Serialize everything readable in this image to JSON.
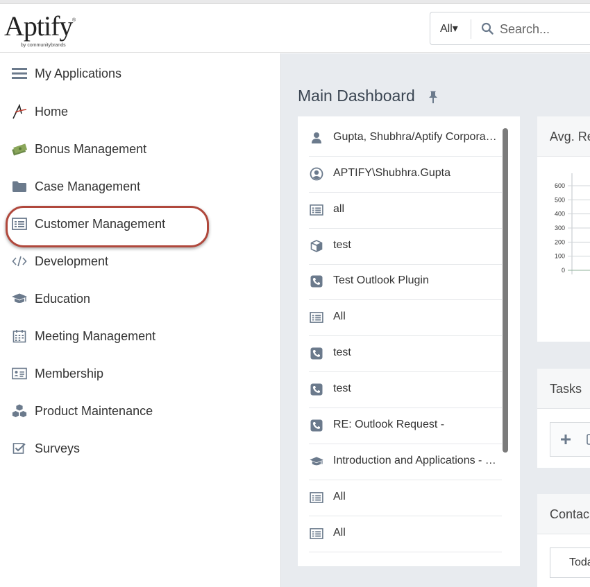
{
  "brand": {
    "logo_text": "Aptify",
    "logo_reg": "®",
    "logo_sub": "by communitybrands"
  },
  "search": {
    "scope": "All▾",
    "placeholder": "Search..."
  },
  "sidebar": {
    "items": [
      {
        "label": "My Applications",
        "icon": "hamburger-menu-icon"
      },
      {
        "label": "Home",
        "icon": "aptify-logo-icon"
      },
      {
        "label": "Bonus Management",
        "icon": "money-icon"
      },
      {
        "label": "Case Management",
        "icon": "folder-icon"
      },
      {
        "label": "Customer Management",
        "icon": "list-icon"
      },
      {
        "label": "Development",
        "icon": "code-icon"
      },
      {
        "label": "Education",
        "icon": "graduation-cap-icon"
      },
      {
        "label": "Meeting Management",
        "icon": "calendar-icon"
      },
      {
        "label": "Membership",
        "icon": "id-card-icon"
      },
      {
        "label": "Product Maintenance",
        "icon": "cubes-icon"
      },
      {
        "label": "Surveys",
        "icon": "checkbox-icon"
      }
    ]
  },
  "main": {
    "title": "Main Dashboard",
    "list": [
      {
        "label": "Gupta, Shubhra/Aptify Corpora…",
        "icon": "person-icon"
      },
      {
        "label": "APTIFY\\Shubhra.Gupta",
        "icon": "user-circle-icon"
      },
      {
        "label": "all",
        "icon": "list-icon"
      },
      {
        "label": "test",
        "icon": "cube-icon"
      },
      {
        "label": "Test Outlook Plugin",
        "icon": "phone-icon"
      },
      {
        "label": "All",
        "icon": "list-icon"
      },
      {
        "label": "test",
        "icon": "phone-icon"
      },
      {
        "label": "test",
        "icon": "phone-icon"
      },
      {
        "label": "RE: Outlook Request -",
        "icon": "phone-icon"
      },
      {
        "label": "Introduction and Applications - …",
        "icon": "graduation-cap-icon"
      },
      {
        "label": "All",
        "icon": "list-icon"
      },
      {
        "label": "All",
        "icon": "list-icon"
      }
    ],
    "cards": {
      "chart_title": "Avg. Re",
      "tasks_title": "Tasks",
      "contacts_title": "Contac",
      "today_label": "Toda"
    }
  },
  "chart_data": {
    "type": "line",
    "title": "",
    "y_ticks": [
      "600",
      "500",
      "400",
      "300",
      "200",
      "100",
      "0"
    ],
    "ylim": [
      0,
      600
    ]
  },
  "colors": {
    "highlight": "#b0483c",
    "icon": "#6b7a8c",
    "main_bg": "#e8ebef"
  }
}
